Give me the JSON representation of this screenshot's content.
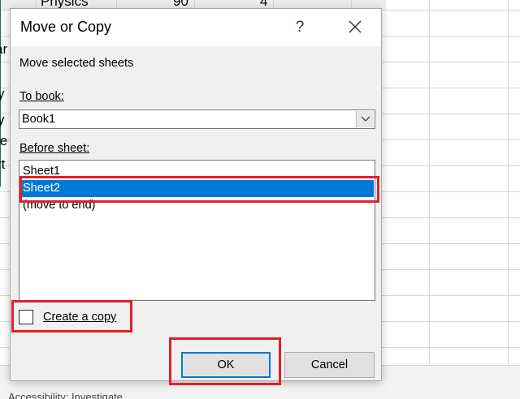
{
  "spreadsheet": {
    "row_top": {
      "subject": "Physics",
      "value1": "90",
      "value2": "4"
    },
    "left_fragments": [
      "ar",
      "y",
      "y",
      "ie",
      "rt"
    ],
    "status_text": "Accessibility: Investigate"
  },
  "dialog": {
    "title": "Move or Copy",
    "help_label": "?",
    "subtitle": "Move selected sheets",
    "to_book_label": "To book:",
    "to_book_value": "Book1",
    "before_sheet_label": "Before sheet:",
    "sheets": [
      "Sheet1",
      "Sheet2",
      "(move to end)"
    ],
    "selected_sheet": "Sheet2",
    "create_copy_label": "Create a copy",
    "create_copy_checked": false,
    "ok_label": "OK",
    "cancel_label": "Cancel"
  },
  "colors": {
    "selection": "#0078d7",
    "highlight": "#e0202a",
    "excel_green": "#217346"
  },
  "icons": [
    "close-icon",
    "chevron-down-icon"
  ]
}
